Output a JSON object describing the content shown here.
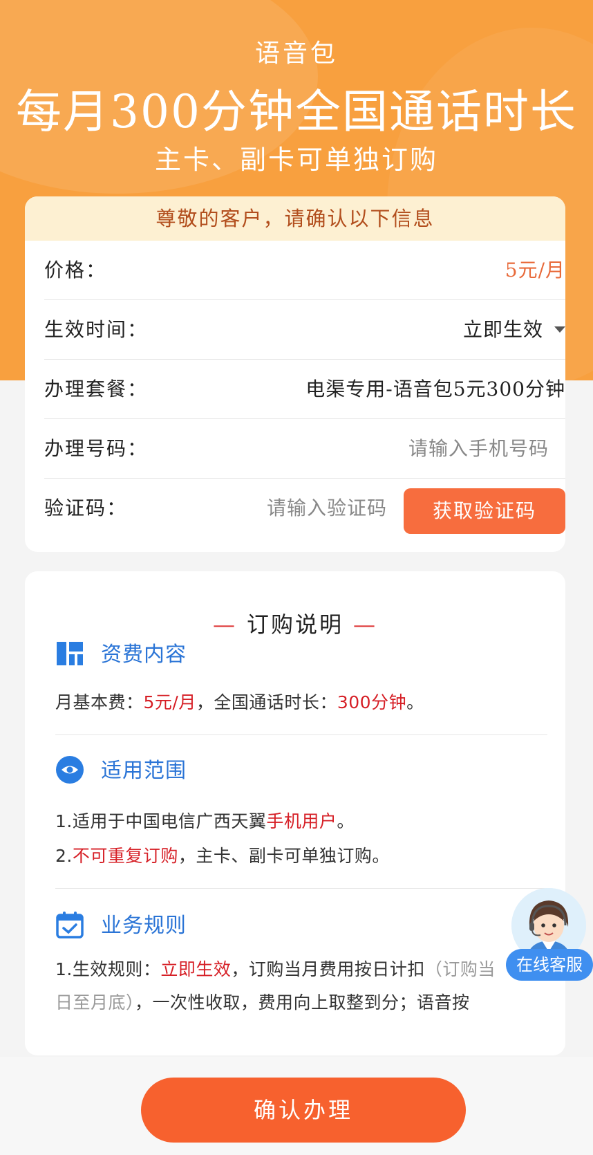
{
  "hero": {
    "subtitle": "语音包",
    "title": "每月300分钟全国通话时长",
    "description": "主卡、副卡可单独订购"
  },
  "info_card": {
    "header": "尊敬的客户，请确认以下信息",
    "price": {
      "label": "价格：",
      "value": "5元/月"
    },
    "effective_time": {
      "label": "生效时间：",
      "value": "立即生效"
    },
    "package": {
      "label": "办理套餐：",
      "value": "电渠专用-语音包5元300分钟"
    },
    "phone": {
      "label": "办理号码：",
      "placeholder": "请输入手机号码"
    },
    "verify": {
      "label": "验证码：",
      "placeholder": "请输入验证码",
      "button": "获取验证码"
    }
  },
  "description": {
    "title": "订购说明",
    "title_dash": "—",
    "fees": {
      "title": "资费内容",
      "icon": "grid-icon",
      "text_a": "月基本费：",
      "text_b": "5元/月",
      "text_c": "，全国通话时长：",
      "text_d": "300分钟",
      "text_e": "。"
    },
    "scope": {
      "title": "适用范围",
      "icon": "eye-icon",
      "line1_a": "1.适用于中国电信广西天翼",
      "line1_b": "手机用户",
      "line1_c": "。",
      "line2_a": "2.",
      "line2_b": "不可重复订购",
      "line2_c": "，主卡、副卡可单独订购。"
    },
    "rules": {
      "title": "业务规则",
      "icon": "calendar-check-icon",
      "line1_a": "1.生效规则：",
      "line1_b": "立即生效",
      "line1_c": "，订购当月费用按日计扣",
      "line1_d": "（订购当",
      "line2_a": "日至月底）",
      "line2_b": "，一次性收取，费用向上取整到分；语音按"
    }
  },
  "service": {
    "label": "在线客服",
    "icon": "customer-service-avatar-icon"
  },
  "confirm_button": "确认办理",
  "colors": {
    "hero": "#f8a03f",
    "accent": "#f7612e",
    "highlight": "#d61f26",
    "section_title": "#2a74d6"
  }
}
